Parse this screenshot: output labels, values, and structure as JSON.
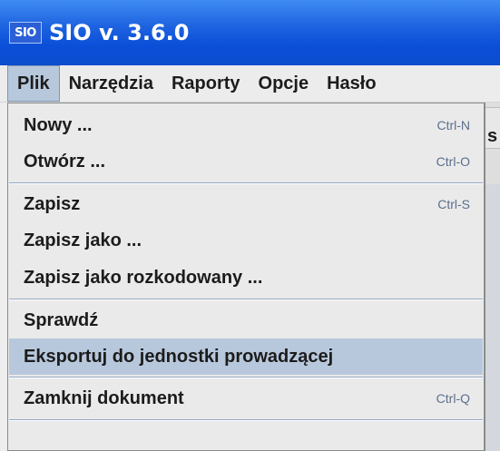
{
  "window": {
    "app_icon_text": "SIO",
    "title": "SIO v. 3.6.0"
  },
  "menubar": {
    "items": [
      "Plik",
      "Narzędzia",
      "Raporty",
      "Opcje",
      "Hasło"
    ],
    "active": "Plik"
  },
  "background": {
    "peek_text": "s"
  },
  "dropdown": {
    "items": [
      {
        "label": "Nowy ...",
        "shortcut": "Ctrl-N"
      },
      {
        "label": "Otwórz ...",
        "shortcut": "Ctrl-O"
      },
      {
        "label": "Zapisz",
        "shortcut": "Ctrl-S"
      },
      {
        "label": "Zapisz jako ...",
        "shortcut": ""
      },
      {
        "label": "Zapisz jako rozkodowany ...",
        "shortcut": ""
      },
      {
        "label": "Sprawdź",
        "shortcut": ""
      },
      {
        "label": "Eksportuj do jednostki prowadzącej",
        "shortcut": ""
      },
      {
        "label": "Zamknij dokument",
        "shortcut": "Ctrl-Q"
      }
    ],
    "highlighted": "Eksportuj do jednostki prowadzącej"
  },
  "colors": {
    "titlebar": "#0b4fd8",
    "menu_highlight": "#b8c8dc",
    "shortcut_text": "#5b6f8c"
  }
}
